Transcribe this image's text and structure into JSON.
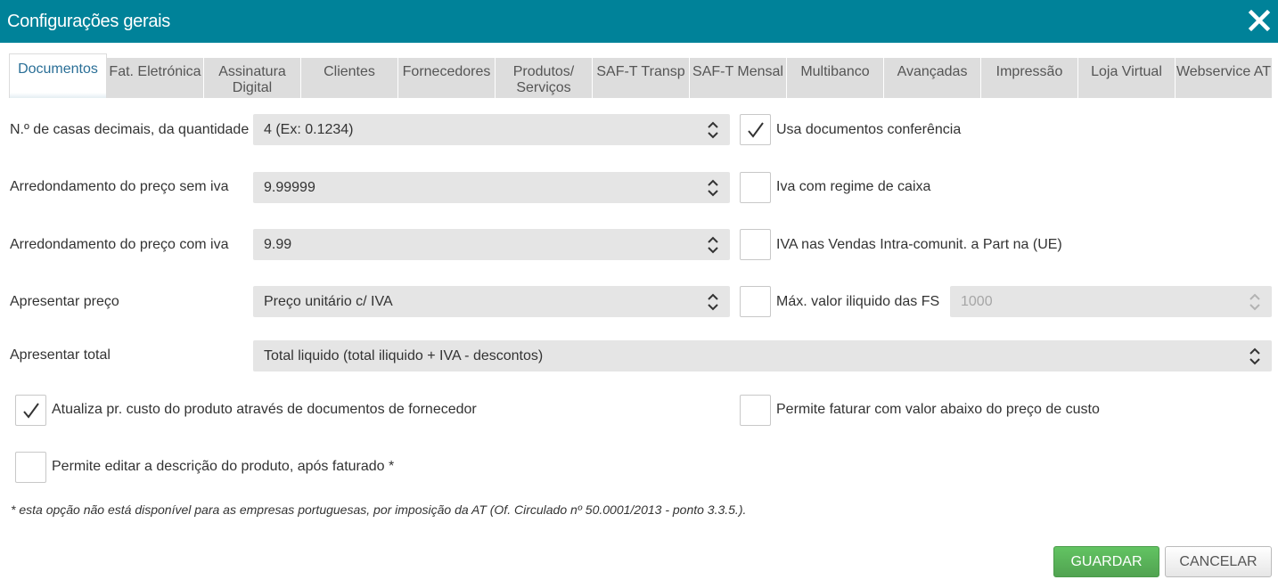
{
  "window": {
    "title": "Configurações gerais"
  },
  "tabs": [
    {
      "label": "Documentos",
      "active": true
    },
    {
      "label": "Fat. Eletrónica"
    },
    {
      "label": "Assinatura Digital"
    },
    {
      "label": "Clientes"
    },
    {
      "label": "Fornecedores"
    },
    {
      "label": "Produtos/ Serviços"
    },
    {
      "label": "SAF-T Transp"
    },
    {
      "label": "SAF-T Mensal"
    },
    {
      "label": "Multibanco"
    },
    {
      "label": "Avançadas"
    },
    {
      "label": "Impressão"
    },
    {
      "label": "Loja Virtual"
    },
    {
      "label": "Webservice AT"
    }
  ],
  "fields": {
    "decimal_places": {
      "label": "N.º de casas decimais, da quantidade",
      "value": "4 (Ex: 0.1234)"
    },
    "rounding_no_vat": {
      "label": "Arredondamento do preço sem iva",
      "value": "9.99999"
    },
    "rounding_with_vat": {
      "label": "Arredondamento do preço com iva",
      "value": "9.99"
    },
    "show_price": {
      "label": "Apresentar preço",
      "value": "Preço unitário c/ IVA"
    },
    "show_total": {
      "label": "Apresentar total",
      "value": "Total liquido (total iliquido + IVA - descontos)"
    },
    "max_net_value": {
      "value": "1000",
      "disabled": true
    }
  },
  "checkboxes": {
    "conference_docs": {
      "label": "Usa documentos conferência",
      "checked": true
    },
    "cash_vat": {
      "label": "Iva com regime de caixa",
      "checked": false
    },
    "intra_community_vat": {
      "label": "IVA nas Vendas Intra-comunit. a Part na (UE)",
      "checked": false
    },
    "max_net_fs": {
      "label": "Máx. valor iliquido das FS",
      "checked": false
    },
    "update_cost": {
      "label": "Atualiza pr. custo do produto através de documentos de fornecedor",
      "checked": true
    },
    "below_cost": {
      "label": "Permite faturar com valor abaixo do preço de custo",
      "checked": false
    },
    "edit_description": {
      "label": "Permite editar a descrição do produto, após faturado *",
      "checked": false
    }
  },
  "note": "* esta opção não está disponível para as empresas portuguesas, por imposição da AT (Of. Circulado nº 50.0001/2013 - ponto 3.3.5.).",
  "buttons": {
    "save": "GUARDAR",
    "cancel": "CANCELAR"
  },
  "colors": {
    "header": "#008299",
    "save": "#5cb85c",
    "tab_active_text": "#2a6f97"
  },
  "icons": {
    "close": "close-icon",
    "select_arrows": "chevron-up-down-icon",
    "check": "checkmark-icon"
  }
}
